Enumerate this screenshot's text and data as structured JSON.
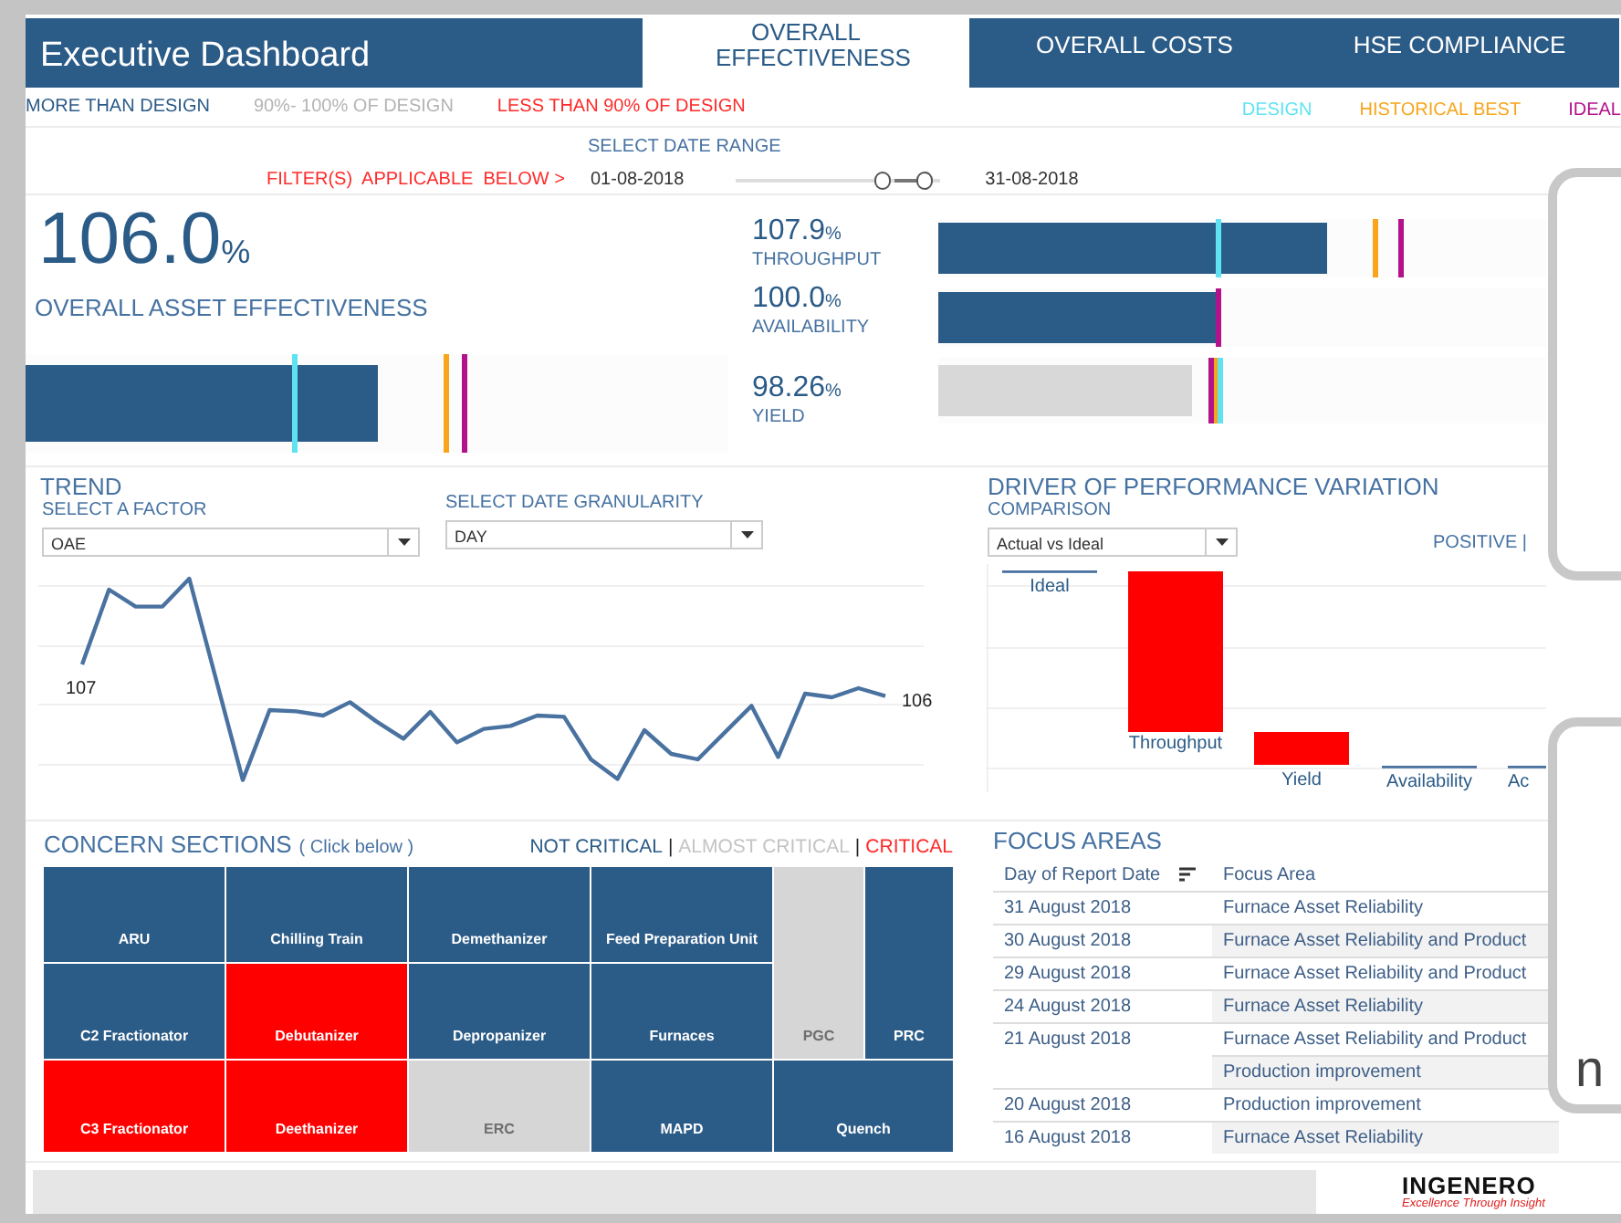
{
  "header": {
    "title": "Executive Dashboard",
    "tabs": [
      {
        "label": "OVERALL EFFECTIVENESS",
        "selected": true
      },
      {
        "label": "OVERALL COSTS",
        "selected": false
      },
      {
        "label": "HSE COMPLIANCE",
        "selected": false
      }
    ]
  },
  "status_legend": [
    {
      "label": "MORE THAN DESIGN",
      "kind": "above"
    },
    {
      "label": "90%- 100% OF DESIGN",
      "kind": "within"
    },
    {
      "label": "LESS THAN 90% OF DESIGN",
      "kind": "below"
    }
  ],
  "marker_legend": [
    {
      "label": "DESIGN",
      "kind": "design"
    },
    {
      "label": "HISTORICAL BEST",
      "kind": "historical_best"
    },
    {
      "label": "IDEAL",
      "kind": "ideal"
    }
  ],
  "date_filter": {
    "heading": "SELECT DATE RANGE",
    "note": "FILTER(S)  APPLICABLE  BELOW >",
    "from": "01-08-2018",
    "to": "31-08-2018",
    "handles": [
      {
        "level": 0.73
      },
      {
        "level": 0.93
      }
    ]
  },
  "headline": {
    "value": "106.0",
    "unit": "%",
    "label": "OVERALL ASSET EFFECTIVENESS",
    "kind": "above",
    "level": 0.5,
    "markers": [
      {
        "kind": "design",
        "level": 0.38
      },
      {
        "kind": "historical_best",
        "level": 0.595
      },
      {
        "kind": "ideal",
        "level": 0.62
      }
    ]
  },
  "factors": [
    {
      "value": "107.9",
      "unit": "%",
      "label": "THROUGHPUT",
      "kind": "above",
      "level": 0.64,
      "markers": [
        {
          "kind": "design",
          "level": 0.455
        },
        {
          "kind": "historical_best",
          "level": 0.715
        },
        {
          "kind": "ideal",
          "level": 0.757
        }
      ]
    },
    {
      "value": "100.0",
      "unit": "%",
      "label": "AVAILABILITY",
      "kind": "above",
      "level": 0.457,
      "markers": [
        {
          "kind": "ideal",
          "level": 0.457
        }
      ]
    },
    {
      "value": "98.26",
      "unit": "%",
      "label": "YIELD",
      "kind": "within",
      "level": 0.418,
      "markers": [
        {
          "kind": "ideal",
          "level": 0.443
        },
        {
          "kind": "historical_best",
          "level": 0.452
        },
        {
          "kind": "design",
          "level": 0.459
        }
      ]
    }
  ],
  "trend": {
    "title": "TREND",
    "factor_label": "SELECT A FACTOR",
    "factor_value": "OAE",
    "granularity_label": "SELECT DATE GRANULARITY",
    "granularity_value": "DAY",
    "start_label": "107",
    "end_label": "106"
  },
  "driver": {
    "title": "DRIVER OF PERFORMANCE VARIATION",
    "comparison_label": "COMPARISON",
    "comparison_value": "Actual vs Ideal",
    "legend": "POSITIVE |",
    "bars": [
      {
        "label": "Ideal",
        "kind": "total"
      },
      {
        "label": "Throughput",
        "kind": "negative"
      },
      {
        "label": "Yield",
        "kind": "negative"
      },
      {
        "label": "Availability",
        "kind": "zero"
      },
      {
        "label": "Ac",
        "kind": "zero"
      }
    ]
  },
  "concern": {
    "title": "CONCERN SECTIONS",
    "hint": "( Click below )",
    "separator": "|",
    "legend": [
      {
        "label": "NOT CRITICAL",
        "kind": "ok"
      },
      {
        "label": "ALMOST CRITICAL",
        "kind": "almost"
      },
      {
        "label": "CRITICAL",
        "kind": "critical"
      }
    ],
    "tiles": [
      {
        "name": "ARU",
        "kind": "ok"
      },
      {
        "name": "Chilling Train",
        "kind": "ok"
      },
      {
        "name": "Demethanizer",
        "kind": "ok"
      },
      {
        "name": "Feed Preparation Unit",
        "kind": "ok"
      },
      {
        "name": "C2 Fractionator",
        "kind": "ok"
      },
      {
        "name": "Debutanizer",
        "kind": "critical"
      },
      {
        "name": "Depropanizer",
        "kind": "ok"
      },
      {
        "name": "Furnaces",
        "kind": "ok"
      },
      {
        "name": "PGC",
        "kind": "almost"
      },
      {
        "name": "PRC",
        "kind": "ok"
      },
      {
        "name": "C3 Fractionator",
        "kind": "critical"
      },
      {
        "name": "Deethanizer",
        "kind": "critical"
      },
      {
        "name": "ERC",
        "kind": "almost"
      },
      {
        "name": "MAPD",
        "kind": "ok"
      },
      {
        "name": "Quench",
        "kind": "ok"
      }
    ]
  },
  "focus": {
    "title": "FOCUS AREAS",
    "columns": [
      "Day of Report Date",
      "Focus Area"
    ],
    "rows": [
      {
        "date": "31 August 2018",
        "area": "Furnace Asset Reliability"
      },
      {
        "date": "30 August 2018",
        "area": "Furnace Asset Reliability and Product"
      },
      {
        "date": "29 August 2018",
        "area": "Furnace Asset Reliability and Product"
      },
      {
        "date": "24 August 2018",
        "area": "Furnace Asset Reliability"
      },
      {
        "date": "21 August 2018",
        "area": "Furnace Asset Reliability and Product"
      },
      {
        "area": "Production improvement"
      },
      {
        "date": "20 August 2018",
        "area": "Production improvement"
      },
      {
        "date": "16 August 2018",
        "area": "Furnace Asset Reliability"
      }
    ]
  },
  "overlays": [
    {
      "kind": "blank"
    },
    {
      "kind": "text",
      "text": "n"
    }
  ],
  "footer": {
    "logo": "INGENERO",
    "tagline": "Excellence Through Insight"
  }
}
